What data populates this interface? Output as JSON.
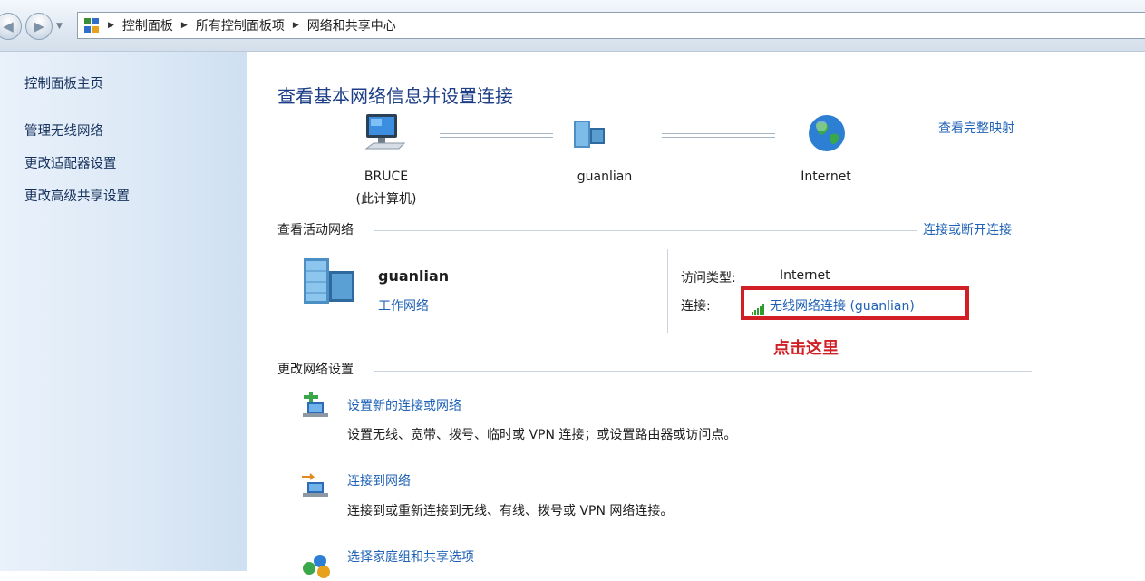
{
  "address_bar": {
    "breadcrumbs": [
      "控制面板",
      "所有控制面板项",
      "网络和共享中心"
    ]
  },
  "sidebar": {
    "home_link": "控制面板主页",
    "links": [
      "管理无线网络",
      "更改适配器设置",
      "更改高级共享设置"
    ]
  },
  "main": {
    "title": "查看基本网络信息并设置连接",
    "full_map_link": "查看完整映射",
    "map": {
      "computer_name": "BRUCE",
      "computer_sub": "(此计算机)",
      "network_name": "guanlian",
      "internet_label": "Internet"
    },
    "active_networks": {
      "section_title": "查看活动网络",
      "connect_disconnect_link": "连接或断开连接",
      "network_name": "guanlian",
      "network_type": "工作网络",
      "access_type_label": "访问类型:",
      "access_type_value": "Internet",
      "connections_label": "连接:",
      "connection_link": "无线网络连接 (guanlian)",
      "annotation": "点击这里"
    },
    "change_settings": {
      "section_title": "更改网络设置",
      "tasks": [
        {
          "link": "设置新的连接或网络",
          "desc": "设置无线、宽带、拨号、临时或 VPN 连接；或设置路由器或访问点。"
        },
        {
          "link": "连接到网络",
          "desc": "连接到或重新连接到无线、有线、拨号或 VPN 网络连接。"
        },
        {
          "link": "选择家庭组和共享选项",
          "desc": ""
        }
      ]
    }
  },
  "colors": {
    "link": "#1f62b5",
    "title": "#1d3f87",
    "annotation": "#d01f25"
  },
  "icons": {
    "back": "back-arrow-icon",
    "forward": "forward-arrow-icon",
    "computer": "computer-monitor-icon",
    "network": "network-building-icon",
    "internet": "globe-icon",
    "signal": "wifi-signal-icon"
  }
}
